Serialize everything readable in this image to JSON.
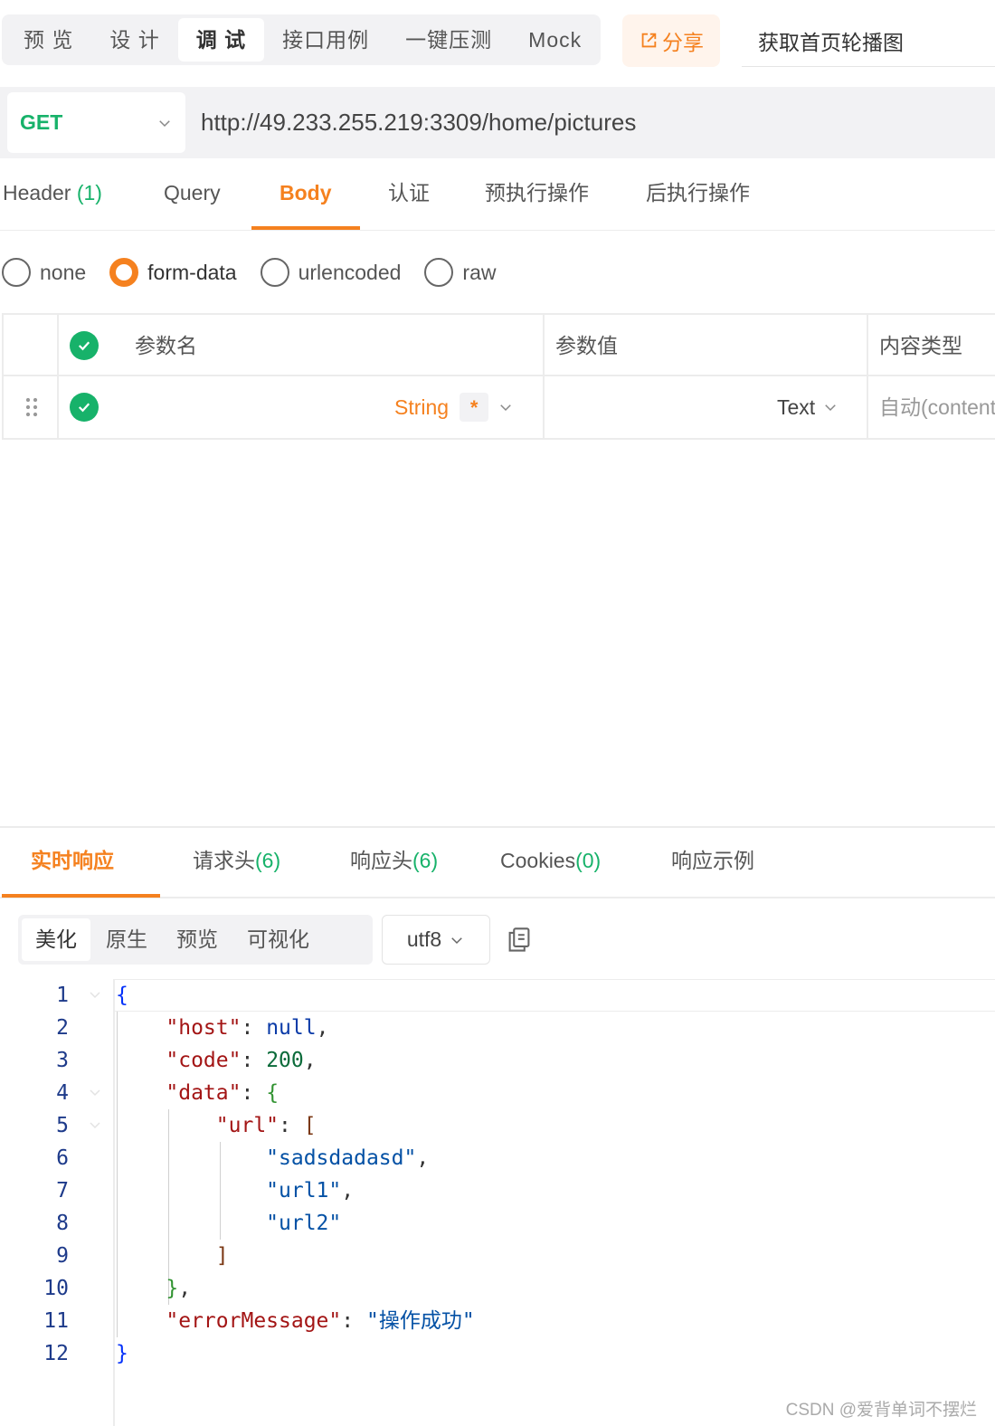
{
  "mode_tabs": [
    "预 览",
    "设 计",
    "调 试",
    "接口用例",
    "一键压测",
    "Mock"
  ],
  "mode_tabs_active": "调 试",
  "share_label": "分享",
  "api_name": "获取首页轮播图",
  "request": {
    "method": "GET",
    "url": "http://49.233.255.219:3309/home/pictures"
  },
  "req_tabs": {
    "header": "Header",
    "header_count": "(1)",
    "query": "Query",
    "body": "Body",
    "auth": "认证",
    "pre": "预执行操作",
    "post": "后执行操作"
  },
  "body_types": [
    "none",
    "form-data",
    "urlencoded",
    "raw"
  ],
  "body_type_selected": "form-data",
  "params_table": {
    "col_name": "参数名",
    "col_value": "参数值",
    "col_content_type": "内容类型",
    "row": {
      "type": "String",
      "required_mark": "*",
      "value_type": "Text",
      "content_type": "自动(content"
    }
  },
  "resp_tabs": {
    "realtime": "实时响应",
    "req_headers": "请求头",
    "req_headers_count": "(6)",
    "resp_headers": "响应头",
    "resp_headers_count": "(6)",
    "cookies": "Cookies",
    "cookies_count": "(0)",
    "examples": "响应示例"
  },
  "view_options": [
    "美化",
    "原生",
    "预览",
    "可视化"
  ],
  "view_selected": "美化",
  "encoding": "utf8",
  "line_numbers": [
    "1",
    "2",
    "3",
    "4",
    "5",
    "6",
    "7",
    "8",
    "9",
    "10",
    "11",
    "12"
  ],
  "json_response": {
    "k_host": "\"host\"",
    "v_host": "null",
    "k_code": "\"code\"",
    "v_code": "200",
    "k_data": "\"data\"",
    "k_url": "\"url\"",
    "url_items": [
      "\"sadsdadasd\"",
      "\"url1\"",
      "\"url2\""
    ],
    "k_error": "\"errorMessage\"",
    "v_error": "\"操作成功\""
  },
  "colors": {
    "accent": "#f5811f",
    "success": "#17b26a"
  },
  "watermark": "CSDN @爱背单词不摆烂"
}
